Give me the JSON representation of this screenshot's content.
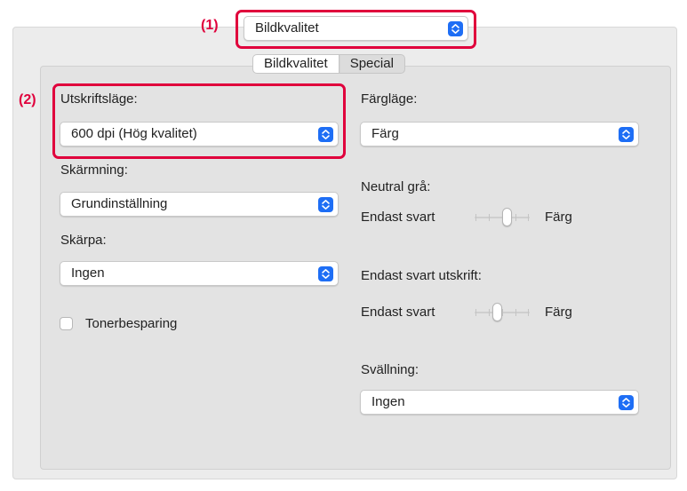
{
  "callouts": {
    "one": "(1)",
    "two": "(2)"
  },
  "preset_popup": {
    "value": "Bildkvalitet"
  },
  "tabs": [
    {
      "label": "Bildkvalitet",
      "selected": true
    },
    {
      "label": "Special",
      "selected": false
    }
  ],
  "left": {
    "print_mode": {
      "label": "Utskriftsläge:",
      "value": "600 dpi (Hög kvalitet)"
    },
    "screening": {
      "label": "Skärmning:",
      "value": "Grundinställning"
    },
    "sharpness": {
      "label": "Skärpa:",
      "value": "Ingen"
    },
    "toner_save": {
      "label": "Tonerbesparing",
      "checked": false
    }
  },
  "right": {
    "color_mode": {
      "label": "Färgläge:",
      "value": "Färg"
    },
    "neutral_gray": {
      "label": "Neutral grå:",
      "min_label": "Endast svart",
      "max_label": "Färg",
      "level": 0.6
    },
    "black_only_print": {
      "label": "Endast svart utskrift:",
      "min_label": "Endast svart",
      "max_label": "Färg",
      "level": 0.4
    },
    "swelling": {
      "label": "Svällning:",
      "value": "Ingen"
    }
  },
  "colors": {
    "accent": "#1e6ef5",
    "callout": "#e0003c"
  },
  "icons": {
    "popup_arrows": "chevron-up-down-icon"
  }
}
